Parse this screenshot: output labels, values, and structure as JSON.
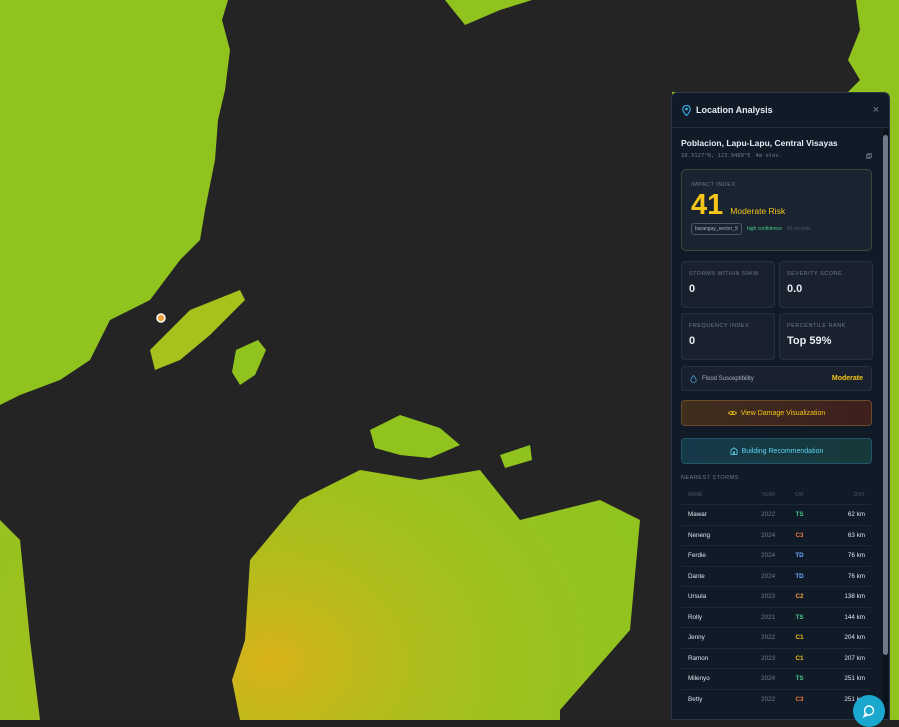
{
  "panel": {
    "title": "Location Analysis",
    "close": "×",
    "location": "Poblacion, Lapu-Lapu, Central Visayas",
    "coords": "10.3127°N, 123.9489°E",
    "elevation": "4m elev.",
    "impact": {
      "label": "IMPACT INDEX",
      "value": "41",
      "risk": "Moderate Risk",
      "tag": "barangay_sector_9",
      "confidence": "high confidence",
      "records": "45 records"
    },
    "stats": [
      {
        "label": "STORMS WITHIN 50KM",
        "value": "0"
      },
      {
        "label": "SEVERITY SCORE",
        "value": "0.0"
      },
      {
        "label": "FREQUENCY INDEX",
        "value": "0"
      },
      {
        "label": "PERCENTILE RANK",
        "value": "Top 59%"
      }
    ],
    "flood": {
      "label": "Flood Susceptibility",
      "value": "Moderate"
    },
    "btn_damage": "View Damage Visualization",
    "btn_building": "Building Recommendation",
    "nearest_label": "NEAREST STORMS",
    "columns": {
      "name": "NAME",
      "year": "YEAR",
      "cat": "CAT",
      "dist": "DIST"
    },
    "storms": [
      {
        "name": "Mawar",
        "year": "2022",
        "cat": "TS",
        "dist": "62 km"
      },
      {
        "name": "Neneng",
        "year": "2024",
        "cat": "C3",
        "dist": "63 km"
      },
      {
        "name": "Ferdie",
        "year": "2024",
        "cat": "TD",
        "dist": "76 km"
      },
      {
        "name": "Dante",
        "year": "2024",
        "cat": "TD",
        "dist": "76 km"
      },
      {
        "name": "Ursula",
        "year": "2023",
        "cat": "C2",
        "dist": "138 km"
      },
      {
        "name": "Rolly",
        "year": "2021",
        "cat": "TS",
        "dist": "144 km"
      },
      {
        "name": "Jenny",
        "year": "2022",
        "cat": "C1",
        "dist": "204 km"
      },
      {
        "name": "Ramon",
        "year": "2023",
        "cat": "C1",
        "dist": "207 km"
      },
      {
        "name": "Milenyo",
        "year": "2024",
        "cat": "TS",
        "dist": "251 km"
      },
      {
        "name": "Betty",
        "year": "2022",
        "cat": "C3",
        "dist": "251 km"
      }
    ]
  },
  "colors": {
    "accent": "#f5c518",
    "cat": {
      "TS": "#46c98a",
      "TD": "#6ea8ff",
      "C1": "#f5c518",
      "C2": "#f39a3c",
      "C3": "#f3793c"
    }
  }
}
